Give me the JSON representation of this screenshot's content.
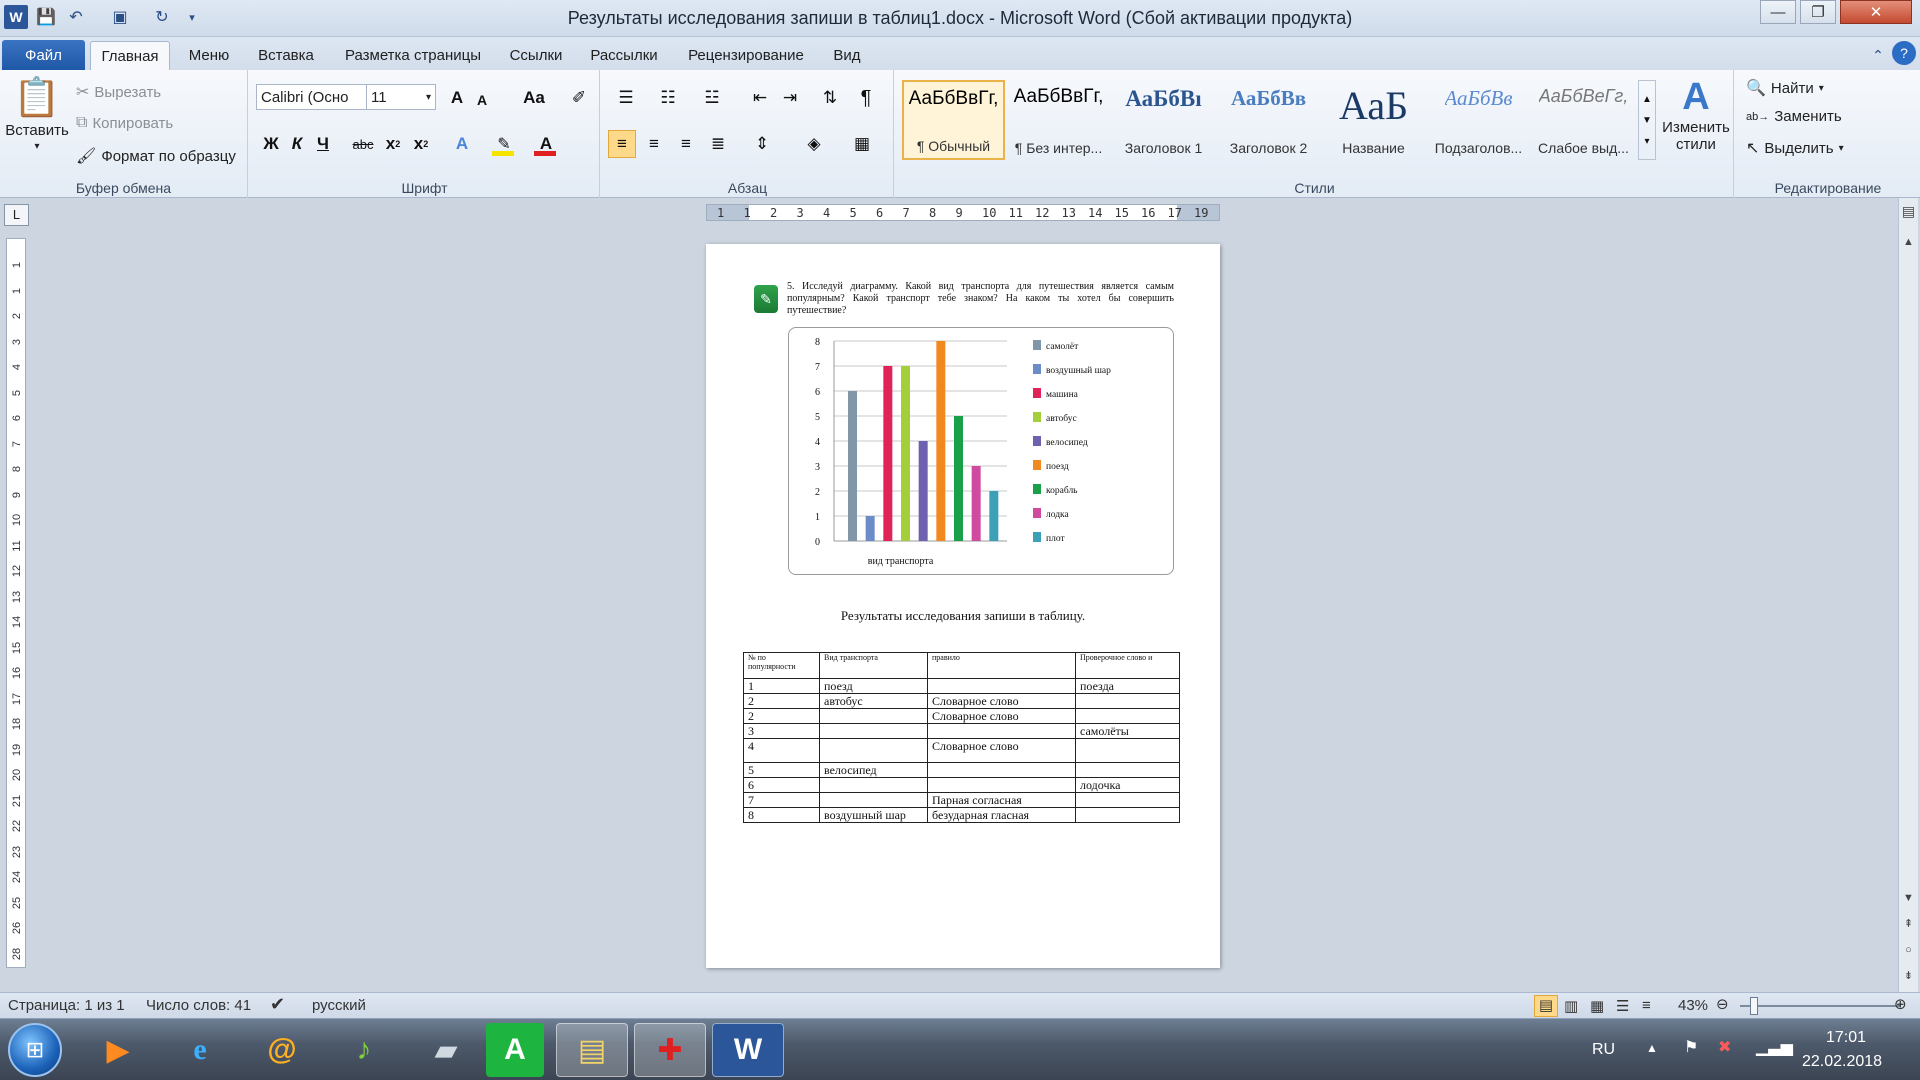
{
  "titlebar": {
    "title": "Результаты исследования запиши в таблиц1.docx - Microsoft Word (Сбой активации продукта)",
    "app_icon": "word-icon",
    "minimize": "—",
    "maximize": "❐",
    "close": "✕"
  },
  "tabs": {
    "file": "Файл",
    "items": [
      "Главная",
      "Меню",
      "Вставка",
      "Разметка страницы",
      "Ссылки",
      "Рассылки",
      "Рецензирование",
      "Вид"
    ],
    "active": "Главная"
  },
  "clipboard": {
    "paste": "Вставить",
    "cut": "Вырезать",
    "copy": "Копировать",
    "format_painter": "Формат по образцу",
    "group_label": "Буфер обмена"
  },
  "font": {
    "name": "Calibri (Осно",
    "size": "11",
    "group_label": "Шрифт",
    "grow": "A",
    "shrink": "A",
    "case": "Aa",
    "bold": "Ж",
    "italic": "К",
    "underline": "Ч",
    "strike": "abc",
    "subscript": "x",
    "superscript": "x",
    "highlight_color": "#f5e400",
    "font_color": "#e02020"
  },
  "paragraph": {
    "group_label": "Абзац",
    "pilcrow": "¶"
  },
  "styles": {
    "group_label": "Стили",
    "change_styles": "Изменить стили",
    "items": [
      {
        "sample": "АаБбВвГг,",
        "name": "¶ Обычный"
      },
      {
        "sample": "АаБбВвГг,",
        "name": "¶ Без интер..."
      },
      {
        "sample": "АаБбВı",
        "name": "Заголовок 1"
      },
      {
        "sample": "АаБбВв",
        "name": "Заголовок 2"
      },
      {
        "sample": "АаБ",
        "name": "Название"
      },
      {
        "sample": "АаБбВв",
        "name": "Подзаголов..."
      },
      {
        "sample": "АаБбВеГг,",
        "name": "Слабое выд..."
      }
    ]
  },
  "editing": {
    "group_label": "Редактирование",
    "find": "Найти",
    "replace": "Заменить",
    "select": "Выделить"
  },
  "ruler": {
    "corner": "L",
    "h_ticks": [
      "1",
      "1",
      "2",
      "3",
      "4",
      "5",
      "6",
      "7",
      "8",
      "9",
      "10",
      "11",
      "12",
      "13",
      "14",
      "15",
      "16",
      "17",
      "19"
    ],
    "v_ticks": [
      "1",
      "1",
      "2",
      "3",
      "4",
      "5",
      "6",
      "7",
      "8",
      "9",
      "10",
      "11",
      "12",
      "13",
      "14",
      "15",
      "16",
      "17",
      "18",
      "19",
      "20",
      "21",
      "22",
      "23",
      "24",
      "25",
      "26",
      "28"
    ]
  },
  "document": {
    "task_text": "5. Исследуй диаграмму. Какой вид транспорта для путешествия является самым популярным? Какой транспорт тебе знаком? На каком ты хотел бы совершить путешествие?",
    "result_heading": "Результаты исследования запиши в таблицу.",
    "table": {
      "headers": [
        "№ по популярности",
        "Вид транспорта",
        "правило",
        "Проверочное слово и"
      ],
      "rows": [
        [
          "1",
          "поезд",
          "",
          "поезда"
        ],
        [
          "2",
          "автобус",
          "Словарное слово",
          ""
        ],
        [
          "2",
          "",
          "Словарное слово",
          ""
        ],
        [
          "3",
          "",
          "",
          "самолёты"
        ],
        [
          "4",
          "",
          "Словарное слово",
          ""
        ],
        [
          "5",
          "велосипед",
          "",
          ""
        ],
        [
          "6",
          "",
          "",
          "лодочка"
        ],
        [
          "7",
          "",
          "Парная согласная",
          ""
        ],
        [
          "8",
          "воздушный шар",
          "безударная гласная",
          ""
        ]
      ]
    }
  },
  "chart_data": {
    "type": "bar",
    "xlabel": "вид транспорта",
    "ylim": [
      0,
      8
    ],
    "yticks": [
      "0",
      "1",
      "2",
      "3",
      "4",
      "5",
      "6",
      "7",
      "8"
    ],
    "grid": true,
    "legend_position": "right",
    "series": [
      {
        "name": "самолёт",
        "value": 6,
        "color": "#7f97a8"
      },
      {
        "name": "воздушный шар",
        "value": 1,
        "color": "#6c8cc8"
      },
      {
        "name": "машина",
        "value": 7,
        "color": "#e0245a"
      },
      {
        "name": "автобус",
        "value": 7,
        "color": "#a5cf3a"
      },
      {
        "name": "велосипед",
        "value": 4,
        "color": "#7060b0"
      },
      {
        "name": "поезд",
        "value": 8,
        "color": "#f08a1e"
      },
      {
        "name": "корабль",
        "value": 5,
        "color": "#1aa048"
      },
      {
        "name": "лодка",
        "value": 3,
        "color": "#d04ba0"
      },
      {
        "name": "плот",
        "value": 2,
        "color": "#3ba0b8"
      }
    ]
  },
  "statusbar": {
    "page": "Страница: 1 из 1",
    "words": "Число слов: 41",
    "language": "русский",
    "zoom": "43%"
  },
  "taskbar": {
    "apps": [
      "media-player-icon",
      "internet-explorer-icon",
      "mail-icon",
      "music-icon",
      "scanner-icon",
      "green-app-icon",
      "file-explorer-icon",
      "medical-app-icon",
      "word-icon"
    ],
    "lang": "RU",
    "time": "17:01",
    "date": "22.02.2018"
  }
}
